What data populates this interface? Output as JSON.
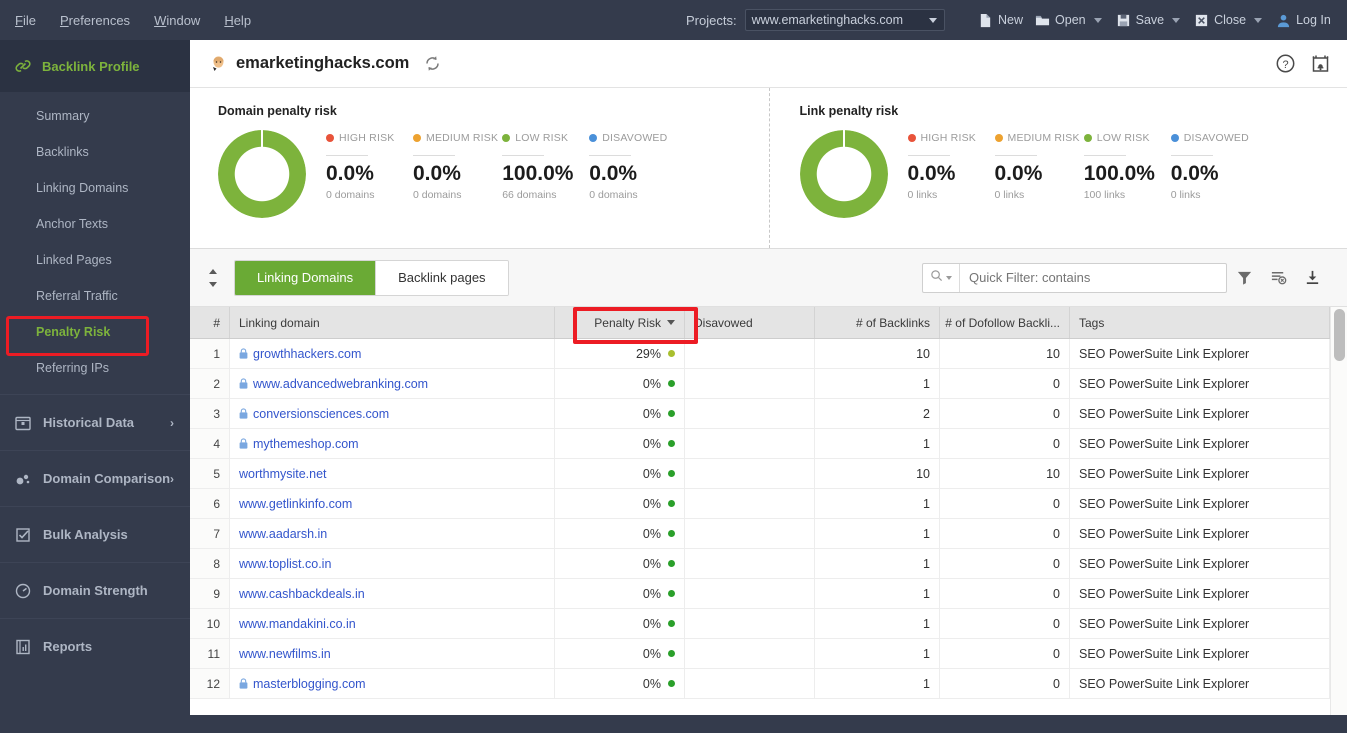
{
  "menubar": {
    "items": [
      {
        "label": "File",
        "mnemonic": "F"
      },
      {
        "label": "Preferences",
        "mnemonic": "P"
      },
      {
        "label": "Window",
        "mnemonic": "W"
      },
      {
        "label": "Help",
        "mnemonic": "H"
      }
    ],
    "projects_label": "Projects:",
    "project_value": "www.emarketinghacks.com",
    "actions": [
      {
        "label": "New",
        "icon": "new-file-icon",
        "has_caret": false
      },
      {
        "label": "Open",
        "icon": "open-folder-icon",
        "has_caret": true
      },
      {
        "label": "Save",
        "icon": "save-disk-icon",
        "has_caret": true
      },
      {
        "label": "Close",
        "icon": "close-x-icon",
        "has_caret": true
      },
      {
        "label": "Log In",
        "icon": "user-icon",
        "has_caret": false
      }
    ]
  },
  "sidebar": {
    "section": {
      "label": "Backlink Profile",
      "icon": "link-chain-icon",
      "chevron": "ⱟ"
    },
    "subitems": [
      {
        "label": "Summary",
        "active": false
      },
      {
        "label": "Backlinks",
        "active": false
      },
      {
        "label": "Linking Domains",
        "active": false
      },
      {
        "label": "Anchor Texts",
        "active": false
      },
      {
        "label": "Linked Pages",
        "active": false
      },
      {
        "label": "Referral Traffic",
        "active": false
      },
      {
        "label": "Penalty Risk",
        "active": true
      },
      {
        "label": "Referring IPs",
        "active": false
      }
    ],
    "groups": [
      {
        "label": "Historical Data",
        "icon": "calendar-icon",
        "chevron": "›"
      },
      {
        "label": "Domain Comparison",
        "icon": "dots-compare-icon",
        "chevron": "›"
      },
      {
        "label": "Bulk Analysis",
        "icon": "checkbox-icon",
        "chevron": ""
      },
      {
        "label": "Domain Strength",
        "icon": "gauge-icon",
        "chevron": ""
      },
      {
        "label": "Reports",
        "icon": "report-chart-icon",
        "chevron": ""
      }
    ]
  },
  "header": {
    "site_title": "emarketinghacks.com",
    "favicon": "site-face-icon",
    "refresh_icon": "refresh-icon",
    "help_icon": "help-circle-icon",
    "schedule_icon": "calendar-bell-icon"
  },
  "risk_panels": [
    {
      "title": "Domain penalty risk",
      "donut_segments": [
        {
          "label": "LOW RISK",
          "percent": 100.0,
          "color": "#7db33c"
        }
      ],
      "stats": [
        {
          "label": "HIGH RISK",
          "color": "#e8533a",
          "value": "0.0%",
          "sub": "0 domains"
        },
        {
          "label": "MEDIUM RISK",
          "color": "#eda230",
          "value": "0.0%",
          "sub": "0 domains"
        },
        {
          "label": "LOW RISK",
          "color": "#7db33c",
          "value": "100.0%",
          "sub": "66 domains"
        },
        {
          "label": "DISAVOWED",
          "color": "#4a90d9",
          "value": "0.0%",
          "sub": "0 domains"
        }
      ]
    },
    {
      "title": "Link penalty risk",
      "donut_segments": [
        {
          "label": "LOW RISK",
          "percent": 100.0,
          "color": "#7db33c"
        }
      ],
      "stats": [
        {
          "label": "HIGH RISK",
          "color": "#e8533a",
          "value": "0.0%",
          "sub": "0 links"
        },
        {
          "label": "MEDIUM RISK",
          "color": "#eda230",
          "value": "0.0%",
          "sub": "0 links"
        },
        {
          "label": "LOW RISK",
          "color": "#7db33c",
          "value": "100.0%",
          "sub": "100 links"
        },
        {
          "label": "DISAVOWED",
          "color": "#4a90d9",
          "value": "0.0%",
          "sub": "0 links"
        }
      ]
    }
  ],
  "table_toolbar": {
    "sort_icon": "sort-updown-icon",
    "tabs": [
      {
        "label": "Linking Domains",
        "active": true
      },
      {
        "label": "Backlink pages",
        "active": false
      }
    ],
    "search_icon": "search-icon",
    "filter_placeholder": "Quick Filter: contains",
    "filter_value": "",
    "icons": [
      {
        "name": "funnel-filter-icon"
      },
      {
        "name": "clear-filter-icon"
      },
      {
        "name": "download-icon"
      }
    ]
  },
  "table": {
    "columns": [
      {
        "key": "idx",
        "label": "#",
        "align": "right"
      },
      {
        "key": "dom",
        "label": "Linking domain",
        "align": "left"
      },
      {
        "key": "risk",
        "label": "Penalty Risk",
        "align": "right",
        "sorted": true
      },
      {
        "key": "dis",
        "label": "Disavowed",
        "align": "left"
      },
      {
        "key": "bl",
        "label": "# of Backlinks",
        "align": "right"
      },
      {
        "key": "dfbl",
        "label": "# of Dofollow Backli...",
        "align": "right"
      },
      {
        "key": "tags",
        "label": "Tags",
        "align": "left"
      }
    ],
    "rows": [
      {
        "idx": "1",
        "domain": "growthhackers.com",
        "secure": true,
        "risk": "29%",
        "risk_color": "#a9bf2e",
        "disavowed": "",
        "backlinks": "10",
        "dofollow": "10",
        "tags": "SEO PowerSuite Link Explorer"
      },
      {
        "idx": "2",
        "domain": "www.advancedwebranking.com",
        "secure": true,
        "risk": "0%",
        "risk_color": "#2aa02a",
        "disavowed": "",
        "backlinks": "1",
        "dofollow": "0",
        "tags": "SEO PowerSuite Link Explorer"
      },
      {
        "idx": "3",
        "domain": "conversionsciences.com",
        "secure": true,
        "risk": "0%",
        "risk_color": "#2aa02a",
        "disavowed": "",
        "backlinks": "2",
        "dofollow": "0",
        "tags": "SEO PowerSuite Link Explorer"
      },
      {
        "idx": "4",
        "domain": "mythemeshop.com",
        "secure": true,
        "risk": "0%",
        "risk_color": "#2aa02a",
        "disavowed": "",
        "backlinks": "1",
        "dofollow": "0",
        "tags": "SEO PowerSuite Link Explorer"
      },
      {
        "idx": "5",
        "domain": "worthmysite.net",
        "secure": false,
        "risk": "0%",
        "risk_color": "#2aa02a",
        "disavowed": "",
        "backlinks": "10",
        "dofollow": "10",
        "tags": "SEO PowerSuite Link Explorer"
      },
      {
        "idx": "6",
        "domain": "www.getlinkinfo.com",
        "secure": false,
        "risk": "0%",
        "risk_color": "#2aa02a",
        "disavowed": "",
        "backlinks": "1",
        "dofollow": "0",
        "tags": "SEO PowerSuite Link Explorer"
      },
      {
        "idx": "7",
        "domain": "www.aadarsh.in",
        "secure": false,
        "risk": "0%",
        "risk_color": "#2aa02a",
        "disavowed": "",
        "backlinks": "1",
        "dofollow": "0",
        "tags": "SEO PowerSuite Link Explorer"
      },
      {
        "idx": "8",
        "domain": "www.toplist.co.in",
        "secure": false,
        "risk": "0%",
        "risk_color": "#2aa02a",
        "disavowed": "",
        "backlinks": "1",
        "dofollow": "0",
        "tags": "SEO PowerSuite Link Explorer"
      },
      {
        "idx": "9",
        "domain": "www.cashbackdeals.in",
        "secure": false,
        "risk": "0%",
        "risk_color": "#2aa02a",
        "disavowed": "",
        "backlinks": "1",
        "dofollow": "0",
        "tags": "SEO PowerSuite Link Explorer"
      },
      {
        "idx": "10",
        "domain": "www.mandakini.co.in",
        "secure": false,
        "risk": "0%",
        "risk_color": "#2aa02a",
        "disavowed": "",
        "backlinks": "1",
        "dofollow": "0",
        "tags": "SEO PowerSuite Link Explorer"
      },
      {
        "idx": "11",
        "domain": "www.newfilms.in",
        "secure": false,
        "risk": "0%",
        "risk_color": "#2aa02a",
        "disavowed": "",
        "backlinks": "1",
        "dofollow": "0",
        "tags": "SEO PowerSuite Link Explorer"
      },
      {
        "idx": "12",
        "domain": "masterblogging.com",
        "secure": true,
        "risk": "0%",
        "risk_color": "#2aa02a",
        "disavowed": "",
        "backlinks": "1",
        "dofollow": "0",
        "tags": "SEO PowerSuite Link Explorer"
      }
    ]
  },
  "annotations": [
    {
      "name": "penalty-risk-sidebar-highlight",
      "color": "#ec1c24"
    },
    {
      "name": "penalty-risk-column-highlight",
      "color": "#ec1c24"
    }
  ],
  "theme": {
    "accent_green": "#6aaa35",
    "sidebar_bg": "#343b4c",
    "sidebar_dark": "#2b3242",
    "link_blue": "#3355cc",
    "annotation_red": "#ec1c24"
  }
}
